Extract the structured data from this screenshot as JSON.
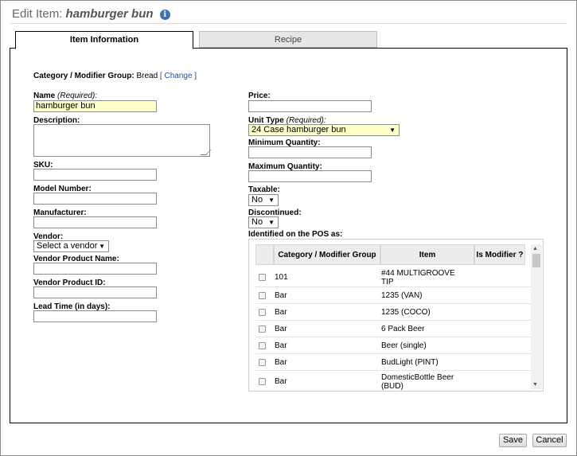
{
  "header": {
    "title_prefix": "Edit Item:",
    "item_name": "hamburger bun",
    "info_icon": "info-icon"
  },
  "tabs": [
    {
      "label": "Item Information",
      "active": true
    },
    {
      "label": "Recipe",
      "active": false
    }
  ],
  "category": {
    "label": "Category / Modifier Group:",
    "value": "Bread",
    "change_link": "[ Change ]"
  },
  "left": {
    "name_label": "Name",
    "required": "(Required):",
    "name_value": "hamburger bun",
    "description_label": "Description:",
    "sku_label": "SKU:",
    "model_label": "Model Number:",
    "manufacturer_label": "Manufacturer:",
    "vendor_label": "Vendor:",
    "vendor_value": "Select a vendor",
    "vendor_product_name_label": "Vendor Product Name:",
    "vendor_product_id_label": "Vendor Product ID:",
    "lead_time_label": "Lead Time (in days):"
  },
  "right": {
    "price_label": "Price:",
    "unit_type_label": "Unit Type",
    "required": "(Required):",
    "unit_type_value": "24 Case hamburger bun",
    "min_qty_label": "Minimum Quantity:",
    "max_qty_label": "Maximum Quantity:",
    "taxable_label": "Taxable:",
    "taxable_value": "No",
    "discontinued_label": "Discontinued:",
    "discontinued_value": "No",
    "pos_label": "Identified on the POS as:"
  },
  "pos_table": {
    "headers": {
      "category": "Category / Modifier Group",
      "item": "Item",
      "is_modifier": "Is Modifier ?"
    },
    "rows": [
      {
        "category": "101",
        "item": "#44 MULTIGROOVE TIP"
      },
      {
        "category": "Bar",
        "item": "1235 (VAN)"
      },
      {
        "category": "Bar",
        "item": "1235 (COCO)"
      },
      {
        "category": "Bar",
        "item": "6 Pack Beer"
      },
      {
        "category": "Bar",
        "item": "Beer (single)"
      },
      {
        "category": "Bar",
        "item": "BudLight (PINT)"
      },
      {
        "category": "Bar",
        "item": "DomesticBottle Beer (BUD)"
      }
    ]
  },
  "footer": {
    "save": "Save",
    "cancel": "Cancel"
  }
}
